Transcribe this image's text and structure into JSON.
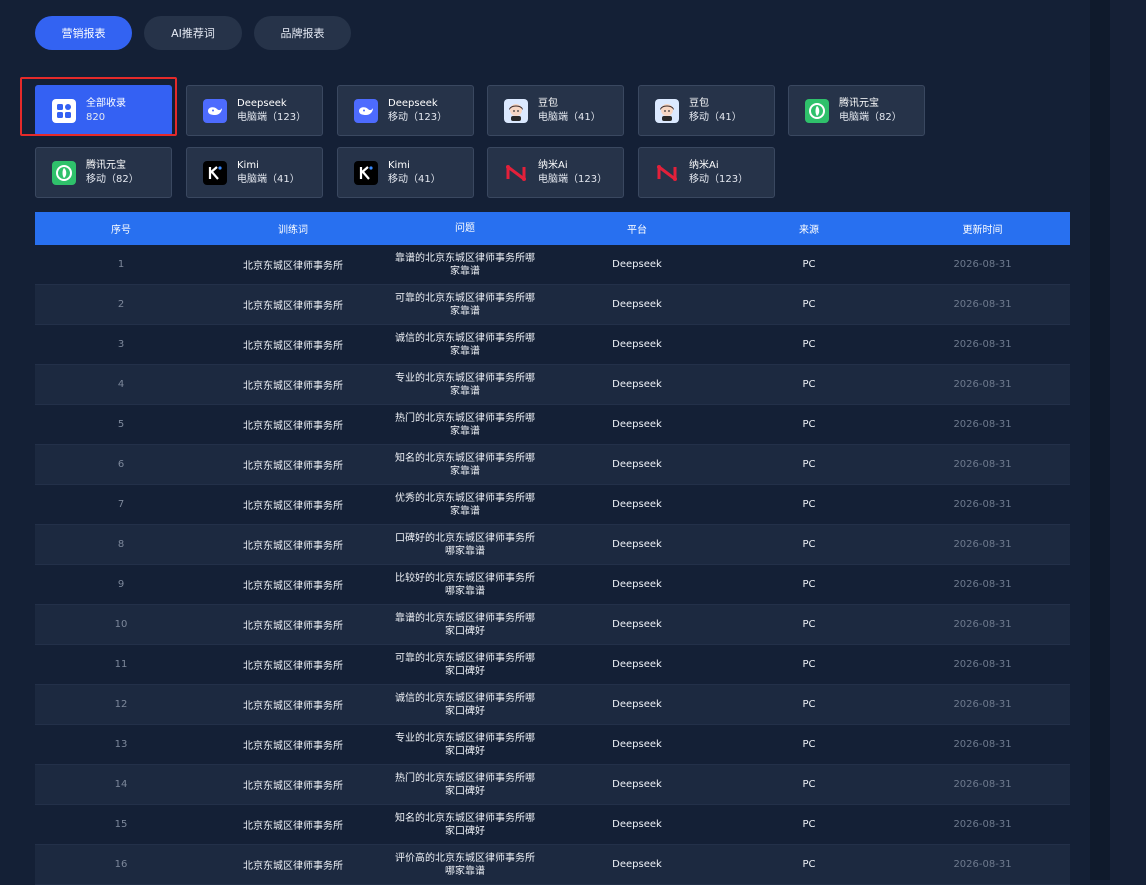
{
  "tabs": [
    {
      "label": "营销报表",
      "active": true
    },
    {
      "label": "AI推荐词",
      "active": false
    },
    {
      "label": "品牌报表",
      "active": false
    }
  ],
  "cards": [
    {
      "name": "全部收录",
      "count": "820",
      "icon": "grid-icon",
      "active": true
    },
    {
      "name": "Deepseek",
      "count": "电脑端（123）",
      "icon": "deepseek-whale-icon"
    },
    {
      "name": "Deepseek",
      "count": "移动（123）",
      "icon": "deepseek-whale-icon"
    },
    {
      "name": "豆包",
      "count": "电脑端（41）",
      "icon": "doubao-avatar-icon"
    },
    {
      "name": "豆包",
      "count": "移动（41）",
      "icon": "doubao-avatar-icon"
    },
    {
      "name": "腾讯元宝",
      "count": "电脑端（82）",
      "icon": "yuanbao-icon"
    },
    {
      "name": "腾讯元宝",
      "count": "移动（82）",
      "icon": "yuanbao-icon"
    },
    {
      "name": "Kimi",
      "count": "电脑端（41）",
      "icon": "kimi-k-icon"
    },
    {
      "name": "Kimi",
      "count": "移动（41）",
      "icon": "kimi-k-icon"
    },
    {
      "name": "纳米Ai",
      "count": "电脑端（123）",
      "icon": "nami-ai-icon"
    },
    {
      "name": "纳米Ai",
      "count": "移动（123）",
      "icon": "nami-ai-icon"
    }
  ],
  "table": {
    "headers": [
      "序号",
      "训练词",
      "问题",
      "平台",
      "来源",
      "更新时间"
    ],
    "rows": [
      [
        "1",
        "北京东城区律师事务所",
        "靠谱的北京东城区律师事务所哪家靠谱",
        "Deepseek",
        "PC",
        "2026-08-31"
      ],
      [
        "2",
        "北京东城区律师事务所",
        "可靠的北京东城区律师事务所哪家靠谱",
        "Deepseek",
        "PC",
        "2026-08-31"
      ],
      [
        "3",
        "北京东城区律师事务所",
        "诚信的北京东城区律师事务所哪家靠谱",
        "Deepseek",
        "PC",
        "2026-08-31"
      ],
      [
        "4",
        "北京东城区律师事务所",
        "专业的北京东城区律师事务所哪家靠谱",
        "Deepseek",
        "PC",
        "2026-08-31"
      ],
      [
        "5",
        "北京东城区律师事务所",
        "热门的北京东城区律师事务所哪家靠谱",
        "Deepseek",
        "PC",
        "2026-08-31"
      ],
      [
        "6",
        "北京东城区律师事务所",
        "知名的北京东城区律师事务所哪家靠谱",
        "Deepseek",
        "PC",
        "2026-08-31"
      ],
      [
        "7",
        "北京东城区律师事务所",
        "优秀的北京东城区律师事务所哪家靠谱",
        "Deepseek",
        "PC",
        "2026-08-31"
      ],
      [
        "8",
        "北京东城区律师事务所",
        "口碑好的北京东城区律师事务所哪家靠谱",
        "Deepseek",
        "PC",
        "2026-08-31"
      ],
      [
        "9",
        "北京东城区律师事务所",
        "比较好的北京东城区律师事务所哪家靠谱",
        "Deepseek",
        "PC",
        "2026-08-31"
      ],
      [
        "10",
        "北京东城区律师事务所",
        "靠谱的北京东城区律师事务所哪家口碑好",
        "Deepseek",
        "PC",
        "2026-08-31"
      ],
      [
        "11",
        "北京东城区律师事务所",
        "可靠的北京东城区律师事务所哪家口碑好",
        "Deepseek",
        "PC",
        "2026-08-31"
      ],
      [
        "12",
        "北京东城区律师事务所",
        "诚信的北京东城区律师事务所哪家口碑好",
        "Deepseek",
        "PC",
        "2026-08-31"
      ],
      [
        "13",
        "北京东城区律师事务所",
        "专业的北京东城区律师事务所哪家口碑好",
        "Deepseek",
        "PC",
        "2026-08-31"
      ],
      [
        "14",
        "北京东城区律师事务所",
        "热门的北京东城区律师事务所哪家口碑好",
        "Deepseek",
        "PC",
        "2026-08-31"
      ],
      [
        "15",
        "北京东城区律师事务所",
        "知名的北京东城区律师事务所哪家口碑好",
        "Deepseek",
        "PC",
        "2026-08-31"
      ],
      [
        "16",
        "北京东城区律师事务所",
        "评价高的北京东城区律师事务所哪家靠谱",
        "Deepseek",
        "PC",
        "2026-08-31"
      ]
    ]
  },
  "colors": {
    "accent": "#3363f2",
    "header": "#2870f0",
    "highlight": "#e52a2a",
    "background": "#142036"
  }
}
